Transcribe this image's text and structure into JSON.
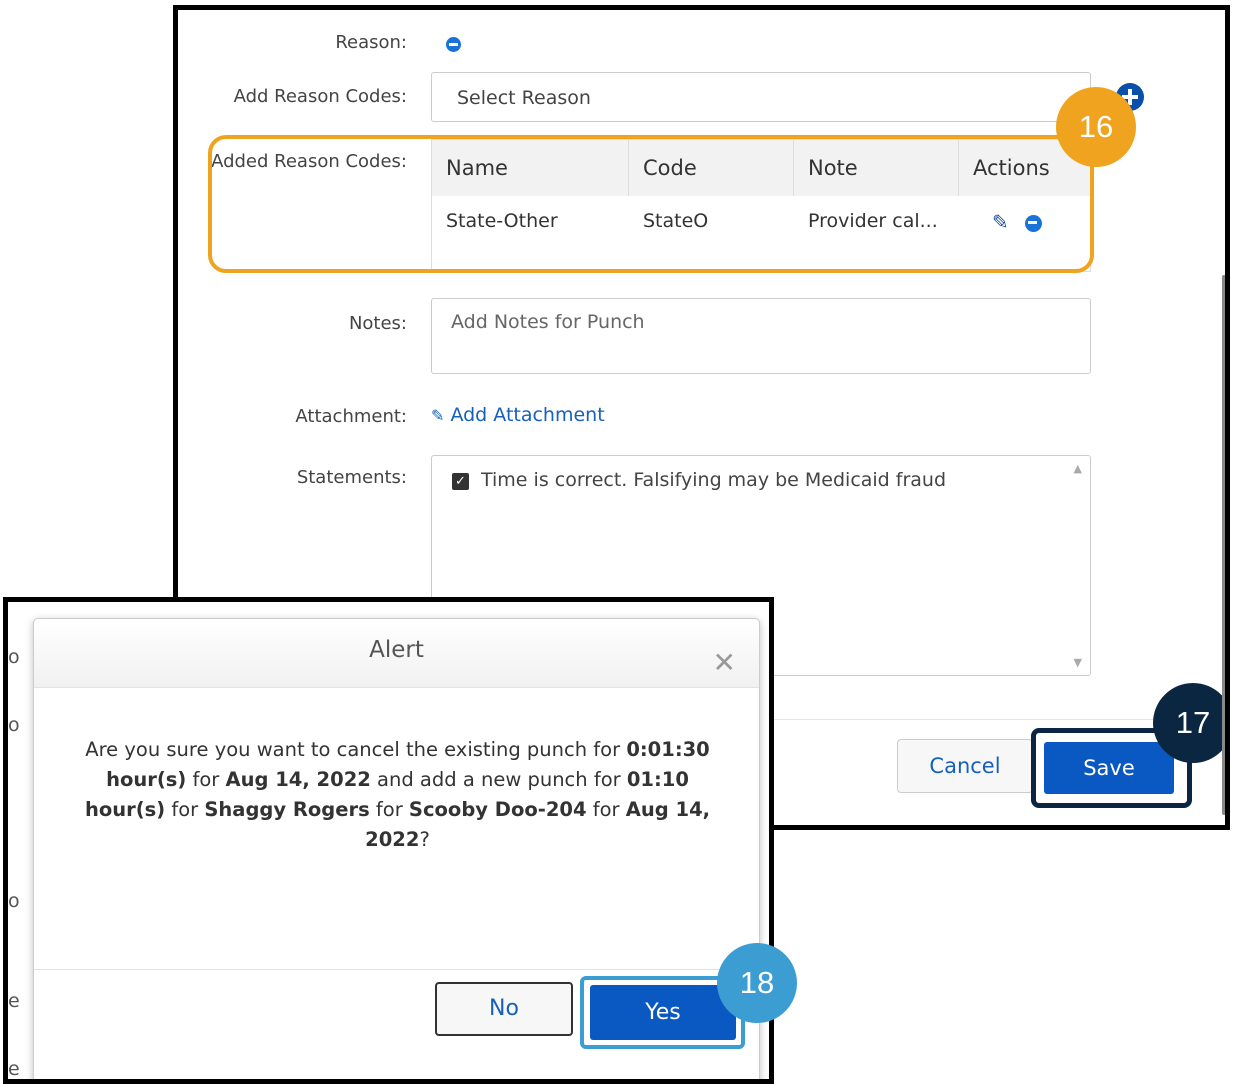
{
  "form": {
    "reason_label": "Reason:",
    "add_reason_codes_label": "Add Reason Codes:",
    "select_reason_placeholder": "Select Reason",
    "added_reason_codes_label": "Added Reason Codes:",
    "table_headers": [
      "Name",
      "Code",
      "Note",
      "Actions"
    ],
    "table_rows": [
      {
        "name": "State-Other",
        "code": "StateO",
        "note": "Provider cal..."
      }
    ],
    "notes_label": "Notes:",
    "notes_placeholder": "Add Notes for Punch",
    "attachment_label": "Attachment:",
    "add_attachment": "Add Attachment",
    "statements_label": "Statements:",
    "statement_text": "Time is correct. Falsifying may be Medicaid fraud",
    "statement_checked": true,
    "cancel_label": "Cancel",
    "save_label": "Save"
  },
  "callouts": {
    "c16": "16",
    "c17": "17",
    "c18": "18"
  },
  "callout_colors": {
    "c16": "#f0a31e",
    "c17": "#0b2640",
    "c18": "#3b9dd2"
  },
  "background_fragments": [
    "o",
    "o",
    "o",
    "e",
    "e"
  ],
  "alert": {
    "title": "Alert",
    "message_parts": [
      {
        "text": "Are you sure you want to cancel the existing punch for ",
        "bold": false
      },
      {
        "text": "0:01:30 hour(s)",
        "bold": true
      },
      {
        "text": " for ",
        "bold": false
      },
      {
        "text": "Aug 14, 2022",
        "bold": true
      },
      {
        "text": " and add a new punch for ",
        "bold": false
      },
      {
        "text": "01:10 hour(s)",
        "bold": true
      },
      {
        "text": " for ",
        "bold": false
      },
      {
        "text": "Shaggy Rogers",
        "bold": true
      },
      {
        "text": " for ",
        "bold": false
      },
      {
        "text": "Scooby Doo-204",
        "bold": true
      },
      {
        "text": " for ",
        "bold": false
      },
      {
        "text": "Aug 14, 2022",
        "bold": true
      },
      {
        "text": "?",
        "bold": false
      }
    ],
    "no_label": "No",
    "yes_label": "Yes"
  },
  "colors": {
    "primary_button": "#0a58c2",
    "link": "#1660b9"
  }
}
